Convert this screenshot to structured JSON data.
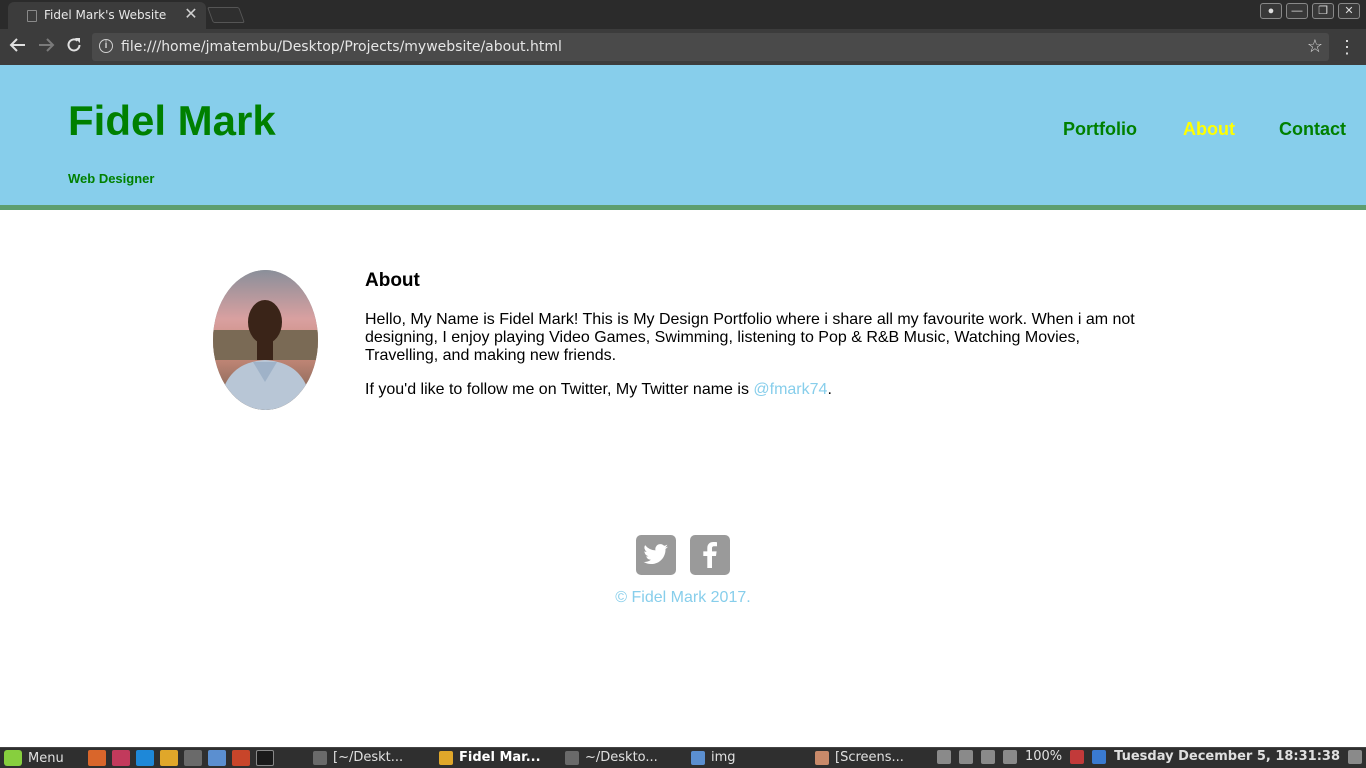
{
  "browser": {
    "tab_title": "Fidel Mark's Website",
    "tab_close": "✕",
    "url": "file:///home/jmatembu/Desktop/Projects/mywebsite/about.html",
    "back_icon": "arrow-left-icon",
    "forward_icon": "arrow-right-icon",
    "reload_icon": "reload-icon",
    "star_icon": "star-icon",
    "window_buttons": [
      "user",
      "minimize",
      "restore",
      "close"
    ]
  },
  "site": {
    "title": "Fidel Mark",
    "subtitle": "Web Designer",
    "nav": [
      {
        "label": "Portfolio",
        "active": false
      },
      {
        "label": "About",
        "active": true
      },
      {
        "label": "Contact",
        "active": false
      }
    ],
    "about": {
      "heading": "About",
      "paragraph1": "Hello, My Name is Fidel Mark! This is My Design Portfolio where i share all my favourite work. When i am not designing, I enjoy playing Video Games, Swimming, listening to Pop & R&B Music, Watching Movies, Travelling, and making new friends.",
      "paragraph2_prefix": "If you'd like to follow me on Twitter, My Twitter name is ",
      "twitter_handle": "@fmark74",
      "paragraph2_suffix": "."
    },
    "footer": {
      "social": [
        "twitter-icon",
        "facebook-icon"
      ],
      "copyright": "© Fidel Mark 2017."
    },
    "colors": {
      "header_bg": "#87ceeb",
      "brand_green": "#008000",
      "active_nav": "#ffff00",
      "link": "#87ceeb"
    }
  },
  "taskbar": {
    "menu_label": "Menu",
    "tasks": [
      {
        "label": "[~/Deskt...",
        "active": false
      },
      {
        "label": "Fidel Mar...",
        "active": true
      },
      {
        "label": "~/Deskto...",
        "active": false
      },
      {
        "label": "img",
        "active": false
      },
      {
        "label": "[Screens...",
        "active": false
      }
    ],
    "battery": "100%",
    "clock": "Tuesday December  5, 18:31:38"
  }
}
